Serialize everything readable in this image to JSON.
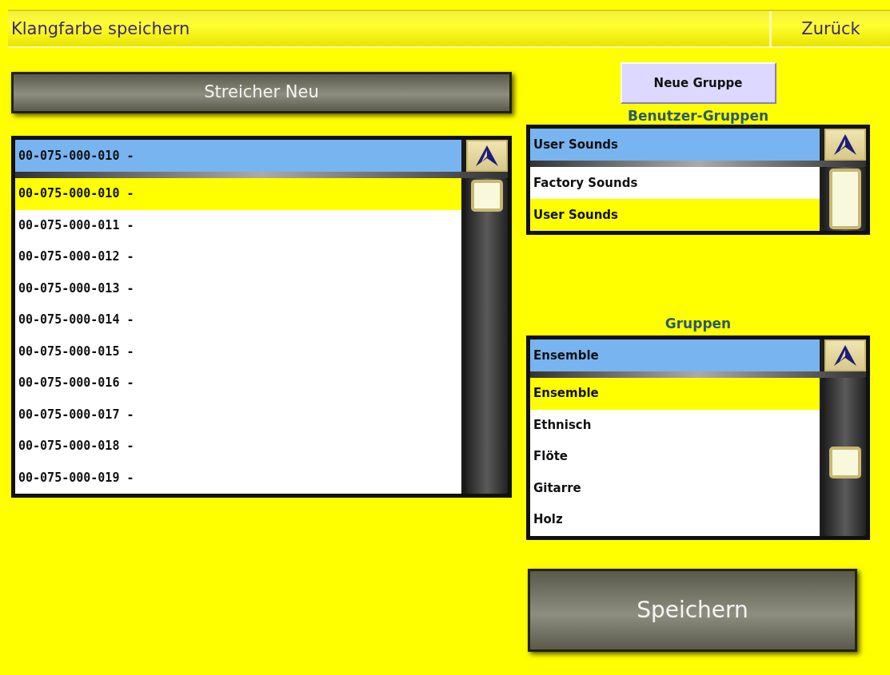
{
  "title_bar": {
    "title": "Klangfarbe speichern",
    "back": "Zurück"
  },
  "name_button": "Streicher Neu",
  "new_group_button": "Neue Gruppe",
  "sound_list": {
    "current": "00-075-000-010 -",
    "items": [
      {
        "label": "00-075-000-010 -",
        "selected": true
      },
      {
        "label": "00-075-000-011 -",
        "selected": false
      },
      {
        "label": "00-075-000-012 -",
        "selected": false
      },
      {
        "label": "00-075-000-013 -",
        "selected": false
      },
      {
        "label": "00-075-000-014 -",
        "selected": false
      },
      {
        "label": "00-075-000-015 -",
        "selected": false
      },
      {
        "label": "00-075-000-016 -",
        "selected": false
      },
      {
        "label": "00-075-000-017 -",
        "selected": false
      },
      {
        "label": "00-075-000-018 -",
        "selected": false
      },
      {
        "label": "00-075-000-019 -",
        "selected": false
      }
    ]
  },
  "user_groups": {
    "heading": "Benutzer-Gruppen",
    "current": "User Sounds",
    "items": [
      {
        "label": "Factory Sounds",
        "selected": false
      },
      {
        "label": "User Sounds",
        "selected": true
      }
    ]
  },
  "groups": {
    "heading": "Gruppen",
    "current": "Ensemble",
    "items": [
      {
        "label": "Ensemble",
        "selected": true
      },
      {
        "label": "Ethnisch",
        "selected": false
      },
      {
        "label": "Flöte",
        "selected": false
      },
      {
        "label": "Gitarre",
        "selected": false
      },
      {
        "label": "Holz",
        "selected": false
      }
    ]
  },
  "save_button": "Speichern"
}
